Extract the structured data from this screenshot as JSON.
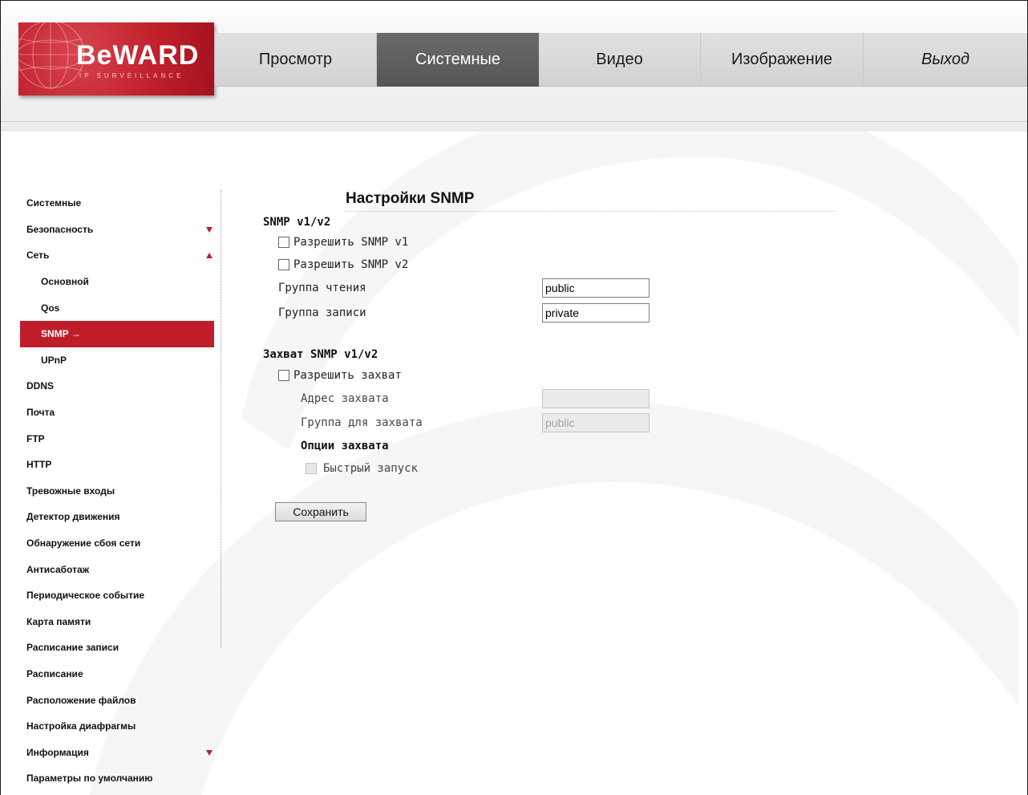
{
  "brand": {
    "logo_text": "BeWARD",
    "logo_sub": "IP SURVEILLANCE"
  },
  "nav": {
    "items": [
      "Просмотр",
      "Системные",
      "Видео",
      "Изображение",
      "Выход"
    ],
    "active": "Системные"
  },
  "sidebar": {
    "items": [
      {
        "label": "Системные"
      },
      {
        "label": "Безопасность",
        "arrow": "down"
      },
      {
        "label": "Сеть",
        "arrow": "up"
      },
      {
        "label": "Основной",
        "sub": true
      },
      {
        "label": "Qos",
        "sub": true
      },
      {
        "label": "SNMP →",
        "sub": true,
        "active": true
      },
      {
        "label": "UPnP",
        "sub": true
      },
      {
        "label": "DDNS"
      },
      {
        "label": "Почта"
      },
      {
        "label": "FTP"
      },
      {
        "label": "HTTP"
      },
      {
        "label": "Тревожные входы"
      },
      {
        "label": "Детектор движения"
      },
      {
        "label": "Обнаружение сбоя сети"
      },
      {
        "label": "Антисаботаж"
      },
      {
        "label": "Периодическое событие"
      },
      {
        "label": "Карта памяти"
      },
      {
        "label": "Расписание записи"
      },
      {
        "label": "Расписание"
      },
      {
        "label": "Расположение файлов"
      },
      {
        "label": "Настройка диафрагмы"
      },
      {
        "label": "Информация",
        "arrow": "down"
      },
      {
        "label": "Параметры по умолчанию"
      }
    ]
  },
  "main": {
    "title": "Настройки SNMP",
    "section1": {
      "title": "SNMP v1/v2",
      "enable_v1": {
        "label": "Разрешить SNMP v1",
        "checked": false
      },
      "enable_v2": {
        "label": "Разрешить SNMP v2",
        "checked": false
      },
      "read_group": {
        "label": "Группа чтения",
        "value": "public"
      },
      "write_group": {
        "label": "Группа записи",
        "value": "private"
      }
    },
    "section2": {
      "title": "Захват SNMP v1/v2",
      "enable_trap": {
        "label": "Разрешить захват",
        "checked": false
      },
      "trap_address": {
        "label": "Адрес захвата",
        "value": ""
      },
      "trap_group": {
        "label": "Группа для захвата",
        "value": "public"
      },
      "options_title": "Опции захвата",
      "fast_start": {
        "label": "Быстрый запуск",
        "checked": false
      }
    },
    "save_label": "Сохранить"
  },
  "colors": {
    "accent": "#c01d2a",
    "nav_active": "#5f5f5f"
  }
}
